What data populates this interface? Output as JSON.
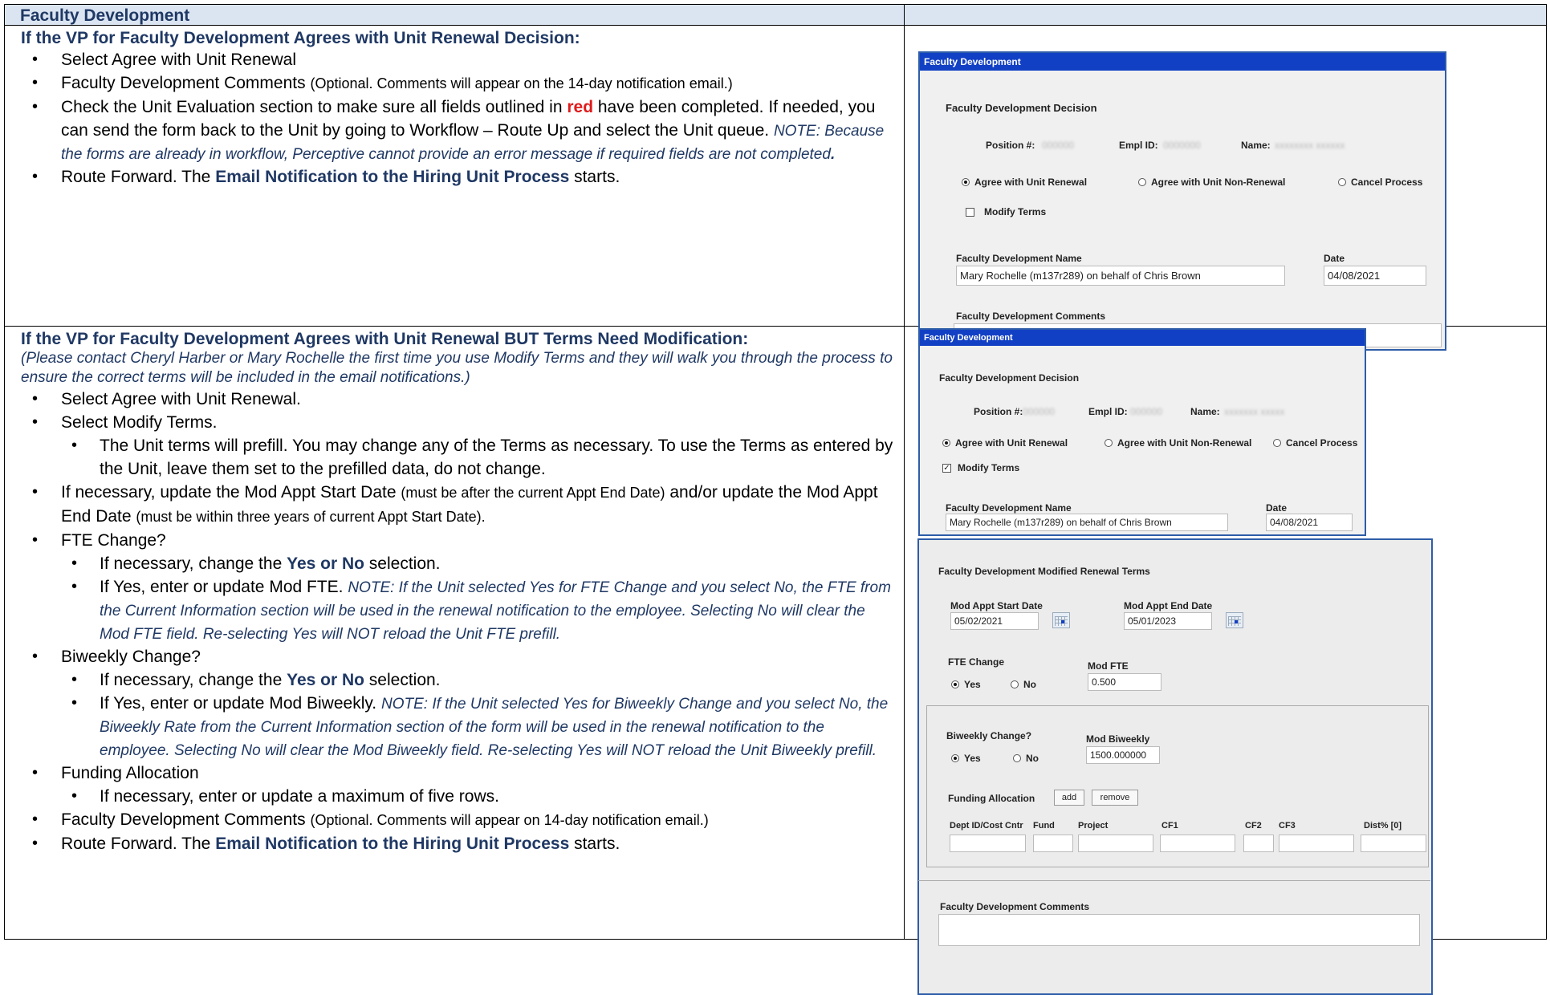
{
  "header": {
    "title": "Faculty Development"
  },
  "section1": {
    "title": "If the VP for Faculty Development Agrees with Unit Renewal Decision:",
    "b1": "Select Agree with Unit Renewal",
    "b2_main": "Faculty Development Comments ",
    "b2_small": "(Optional.  Comments will appear on the 14-day notification email.)",
    "b3_a": "Check the Unit Evaluation section to make sure all fields outlined in ",
    "b3_red": "red",
    "b3_b": " have been completed.  If needed, you can send the form back to the Unit by going to Workflow – Route Up and select the Unit queue.  ",
    "b3_note": "NOTE:  Because the forms are already in workflow, Perceptive cannot provide an error message if required fields are not completed",
    "b3_dot": ".",
    "b4_a": "Route Forward.  The ",
    "b4_bold": "Email Notification to the Hiring Unit Process",
    "b4_b": " starts."
  },
  "section2": {
    "title": "If the VP for Faculty Development Agrees with Unit Renewal BUT Terms Need Modification:",
    "intro": "(Please contact Cheryl Harber or Mary Rochelle the first time you use Modify Terms and they will walk you through the process to ensure the correct terms will be included in the email notifications.)",
    "b1": "Select Agree with Unit Renewal.",
    "b2": "Select Modify Terms.",
    "b2_sub": "The Unit terms will prefill.  You may change any of the Terms as necessary.  To use the Terms as entered by the Unit, leave them set to the prefilled data, do not change.",
    "b3_a": "If necessary, update the Mod Appt Start Date ",
    "b3_s1": "(must be after the current Appt End Date)",
    "b3_b": " and/or update the Mod Appt End Date ",
    "b3_s2": "(must be within three years of current Appt Start Date).",
    "b4": "FTE Change?",
    "b4_sub1_a": "If necessary, change the ",
    "b4_sub1_bold": "Yes or No",
    "b4_sub1_b": " selection.",
    "b4_sub2_a": "If Yes, enter or update Mod FTE.  ",
    "b4_sub2_note": "NOTE:  If the Unit selected Yes for FTE Change and you select No, the FTE from the Current Information section will be used in the renewal notification to the employee.  Selecting No will clear the Mod FTE field.  Re-selecting Yes will NOT reload the Unit FTE prefill.",
    "b5": "Biweekly Change?",
    "b5_sub1_a": "If necessary, change the ",
    "b5_sub1_bold": "Yes or No",
    "b5_sub1_b": " selection.",
    "b5_sub2_a": "If Yes, enter or update Mod Biweekly.  ",
    "b5_sub2_note": "NOTE:  If the Unit selected Yes for Biweekly Change and you select No, the Biweekly Rate from the Current Information section of the form will be used in the renewal notification to the employee.   Selecting No will clear the Mod Biweekly field.  Re-selecting Yes will NOT reload the Unit Biweekly prefill.",
    "b6": "Funding Allocation",
    "b6_sub": "If necessary, enter or update a maximum of five rows.",
    "b7_main": "Faculty Development Comments ",
    "b7_small": "(Optional.  Comments will appear on 14-day notification email.)",
    "b8_a": "Route Forward.  The ",
    "b8_bold": "Email Notification to the Hiring Unit Process",
    "b8_b": " starts."
  },
  "form1": {
    "title": "Faculty Development",
    "decision_heading": "Faculty Development Decision",
    "position_label": "Position #:",
    "empl_label": "Empl ID:",
    "name_label": "Name:",
    "opt_agree": "Agree with Unit Renewal",
    "opt_nonrenew": "Agree with Unit Non-Renewal",
    "opt_cancel": "Cancel Process",
    "modify_terms": "Modify Terms",
    "fd_name_label": "Faculty Development Name",
    "fd_name_value": "Mary Rochelle (m137r289) on behalf of Chris Brown",
    "date_label": "Date",
    "date_value": "04/08/2021",
    "comments_label": "Faculty Development Comments"
  },
  "form2": {
    "title": "Faculty Development",
    "decision_heading": "Faculty Development Decision",
    "position_label": "Position #:",
    "empl_label": "Empl ID:",
    "name_label": "Name:",
    "opt_agree": "Agree with Unit Renewal",
    "opt_nonrenew": "Agree with Unit Non-Renewal",
    "opt_cancel": "Cancel Process",
    "modify_terms": "Modify Terms",
    "check_mark": "✓",
    "fd_name_label": "Faculty Development Name",
    "fd_name_value": "Mary Rochelle (m137r289) on behalf of Chris Brown",
    "date_label": "Date",
    "date_value": "04/08/2021"
  },
  "form3": {
    "heading": "Faculty Development Modified Renewal Terms",
    "start_label": "Mod Appt Start Date",
    "start_value": "05/02/2021",
    "end_label": "Mod Appt End Date",
    "end_value": "05/01/2023",
    "fte_change_label": "FTE Change",
    "yes": "Yes",
    "no": "No",
    "mod_fte_label": "Mod FTE",
    "mod_fte_value": "0.500",
    "biweekly_label": "Biweekly Change?",
    "mod_biweekly_label": "Mod Biweekly",
    "mod_biweekly_value": "1500.000000",
    "funding_label": "Funding Allocation",
    "add": "add",
    "remove": "remove",
    "cols": [
      "Dept ID/Cost Cntr",
      "Fund",
      "Project",
      "CF1",
      "CF2",
      "CF3",
      "Dist% [0]"
    ],
    "comments_label": "Faculty Development Comments"
  }
}
